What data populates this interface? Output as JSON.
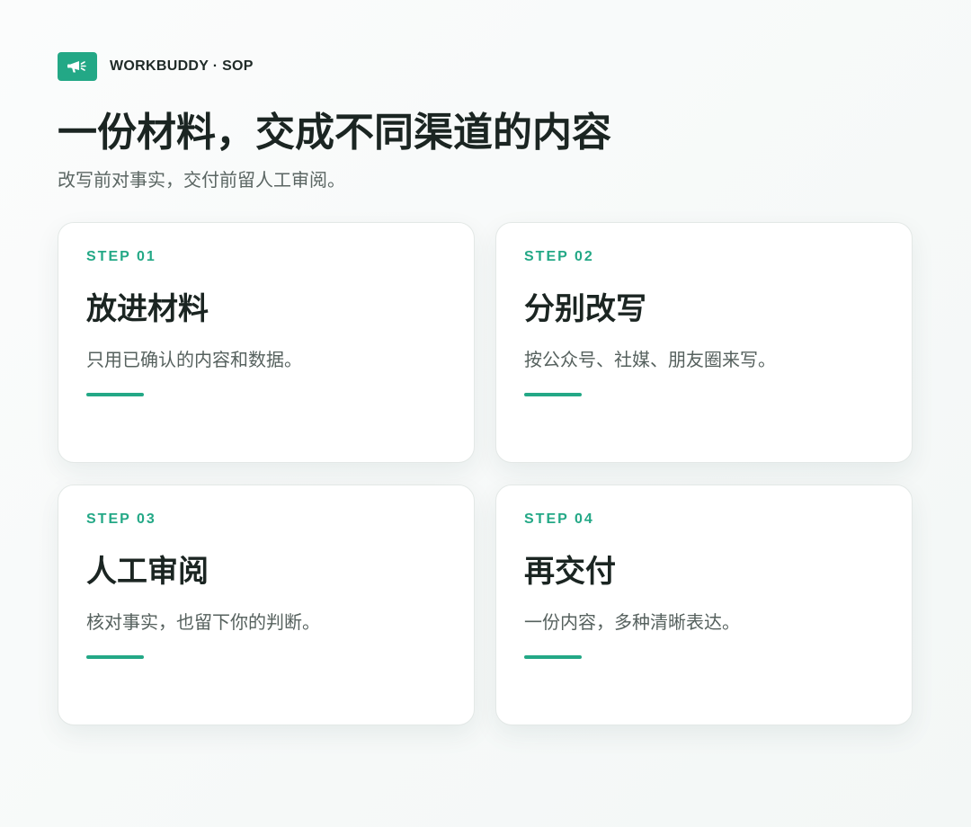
{
  "brand": {
    "name": "WORKBUDDY · SOP",
    "logo_icon": "megaphone-icon",
    "accent_color": "#23a886"
  },
  "header": {
    "title": "一份材料，交成不同渠道的内容",
    "subtitle": "改写前对事实，交付前留人工审阅。"
  },
  "steps": [
    {
      "label": "STEP 01",
      "title": "放进材料",
      "description": "只用已确认的内容和数据。"
    },
    {
      "label": "STEP 02",
      "title": "分别改写",
      "description": "按公众号、社媒、朋友圈来写。"
    },
    {
      "label": "STEP 03",
      "title": "人工审阅",
      "description": "核对事实，也留下你的判断。"
    },
    {
      "label": "STEP 04",
      "title": "再交付",
      "description": "一份内容，多种清晰表达。"
    }
  ]
}
